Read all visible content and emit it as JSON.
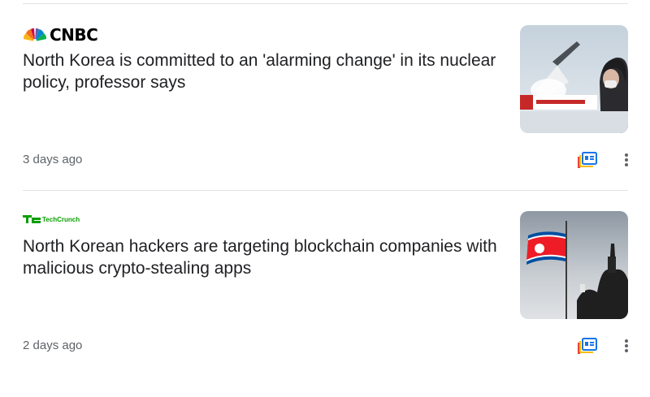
{
  "articles": [
    {
      "source": "CNBC",
      "source_logo_icon": "cnbc-peacock-logo",
      "headline": "North Korea is committed to an 'alarming change' in its nuclear policy, professor says",
      "time": "3 days ago",
      "thumbnail_icon": "missile-launch-news-broadcast",
      "actions": {
        "full_coverage_icon": "full-coverage-icon",
        "more_icon": "more-vert-icon"
      }
    },
    {
      "source": "TechCrunch",
      "source_logo_icon": "techcrunch-logo",
      "headline": "North Korean hackers are targeting blockchain companies with malicious crypto-stealing apps",
      "time": "2 days ago",
      "thumbnail_icon": "north-korean-flag-photo",
      "actions": {
        "full_coverage_icon": "full-coverage-icon",
        "more_icon": "more-vert-icon"
      }
    }
  ],
  "colors": {
    "headline": "#202124",
    "meta": "#5f6368",
    "divider": "#e3e3e3",
    "icon_blue": "#1a73e8",
    "icon_yellow": "#fbbc04",
    "icon_red": "#ea4335",
    "techcrunch_green": "#0a9e01"
  }
}
